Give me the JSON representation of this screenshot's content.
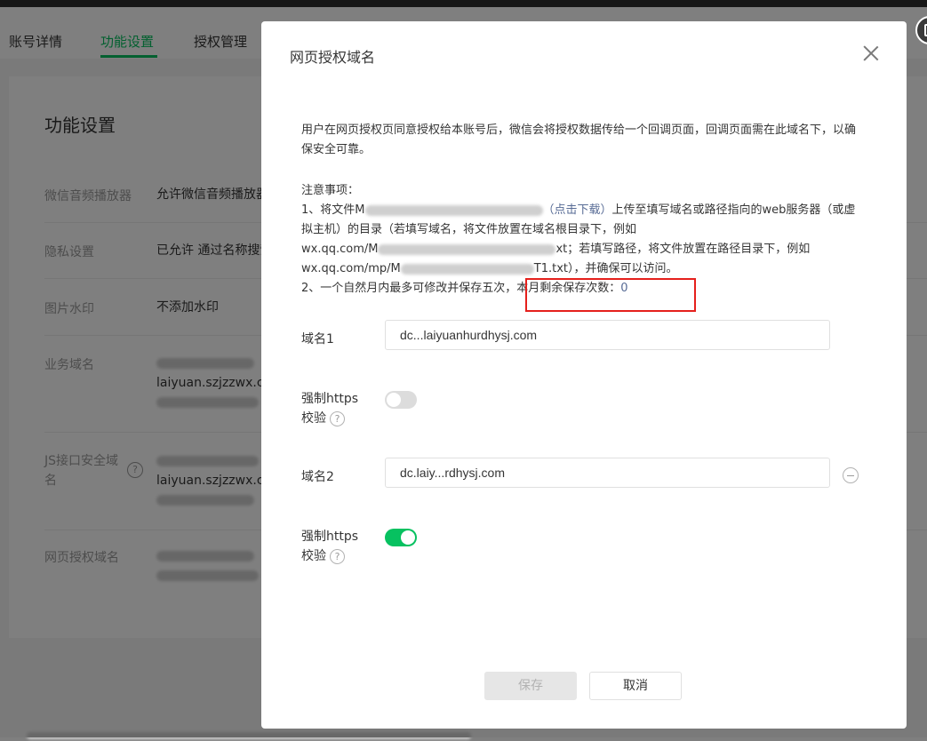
{
  "background": {
    "tabs": [
      "账号详情",
      "功能设置",
      "授权管理"
    ],
    "page_title": "功能设置",
    "rows": [
      {
        "label": "微信音频播放器",
        "value": "允许微信音频播放器"
      },
      {
        "label": "隐私设置",
        "value": "已允许 通过名称搜索"
      },
      {
        "label": "图片水印",
        "value": "不添加水印"
      },
      {
        "label": "业务域名",
        "value_line2": "laiyuan.szjzzwx.co"
      },
      {
        "label": "JS接口安全域名",
        "value_line2": "laiyuan.szjzzwx.co"
      },
      {
        "label": "网页授权域名"
      }
    ],
    "help_glyph": "?"
  },
  "dialog": {
    "title": "网页授权域名",
    "description": "用户在网页授权页同意授权给本账号后，微信会将授权数据传给一个回调页面，回调页面需在此域名下，以确保安全可靠。",
    "notes_title": "注意事项：",
    "note1_prefix": "1、将文件M",
    "note1_link": "（点击下载）",
    "note1_suffix": "上传至填写域名或路径指向的web服务器（或虚拟主机）的目录（若填写域名，将文件放置在域名根目录下，例如",
    "note1_example1_prefix": "wx.qq.com/M",
    "note1_example1_suffix": "xt；若填写路径，将文件放置在路径目录下，例如",
    "note1_example2_prefix": "wx.qq.com/mp/M",
    "note1_example2_suffix": "T1.txt），并确保可以访问。",
    "note2_prefix": "2、一个自然月内最多可修改并保存五次，",
    "remaining_label": "本月剩余保存次数：",
    "remaining_count": "0",
    "domain1_label": "域名1",
    "domain1_value": "dc...laiyuanhurdhysj.com",
    "force_https_label": "强制https",
    "verify_label": "校验",
    "help_glyph": "?",
    "domain2_label": "域名2",
    "domain2_value": "dc.laiy...rdhysj.com",
    "switch1_on": false,
    "switch2_on": true,
    "save_label": "保存",
    "cancel_label": "取消"
  },
  "colors": {
    "accent": "#07c160",
    "link": "#576b95",
    "highlight_box": "#e5201c"
  }
}
